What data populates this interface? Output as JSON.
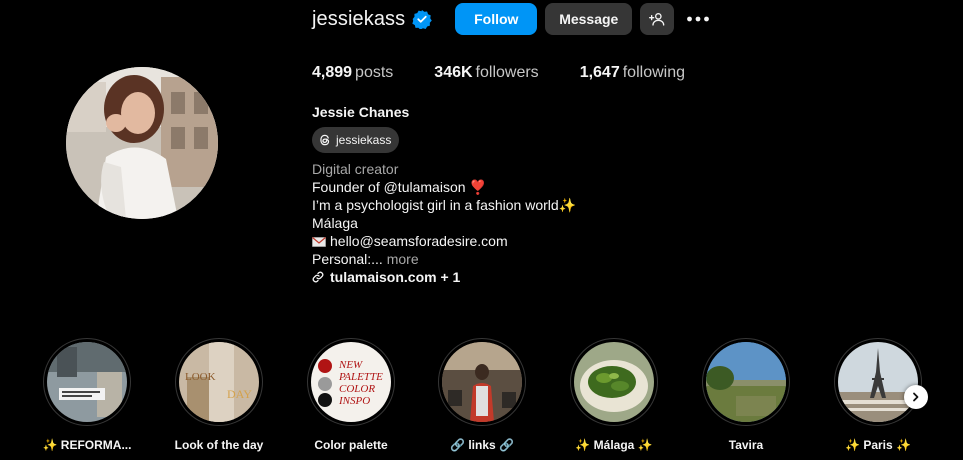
{
  "profile": {
    "username": "jessiekass",
    "full_name": "Jessie Chanes",
    "threads_handle": "jessiekass",
    "verified": true
  },
  "actions": {
    "follow_label": "Follow",
    "message_label": "Message"
  },
  "stats": {
    "posts_count": "4,899",
    "posts_label": "posts",
    "followers_count": "346K",
    "followers_label": "followers",
    "following_count": "1,647",
    "following_label": "following"
  },
  "bio": {
    "category": "Digital creator",
    "line1": "Founder of @tulamaison ❣️",
    "line2": "I’m a psychologist girl in a fashion world✨",
    "line3": "Málaga",
    "line4": "hello@seamsforadesire.com",
    "line5_prefix": "Personal:...",
    "line5_more": "more",
    "link": "tulamaison.com + 1"
  },
  "highlights": [
    {
      "label": "✨ REFORMA..."
    },
    {
      "label": "Look of the day"
    },
    {
      "label": "Color palette"
    },
    {
      "label": "🔗 links 🔗"
    },
    {
      "label": "✨ Málaga ✨"
    },
    {
      "label": "Tavira"
    },
    {
      "label": "✨ Paris ✨"
    }
  ],
  "colors": {
    "background": "#000000",
    "accent": "#0095f6",
    "secondary_button": "#363636",
    "muted_text": "#a8a8a8"
  },
  "icons": [
    "verified-badge-icon",
    "add-user-icon",
    "more-icon",
    "threads-icon",
    "link-icon",
    "envelope-icon",
    "chevron-right-icon"
  ]
}
